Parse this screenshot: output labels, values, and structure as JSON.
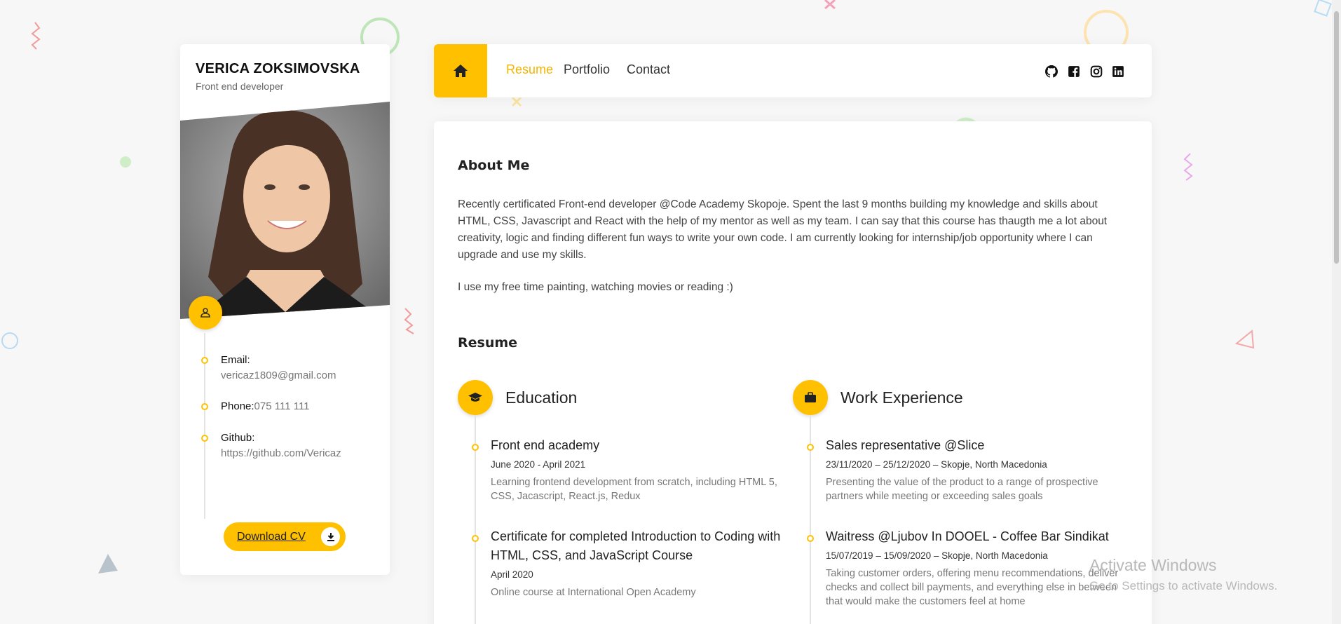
{
  "profile": {
    "name": "VERICA ZOKSIMOVSKA",
    "role": "Front end developer",
    "contacts": [
      {
        "label": "Email:",
        "value": "vericaz1809@gmail.com"
      },
      {
        "label": "Phone:",
        "value": "075 111 111"
      },
      {
        "label": "Github:",
        "value": "https://github.com/Vericaz"
      }
    ],
    "download_label": "Download CV"
  },
  "nav": {
    "links": [
      "Resume",
      "Portfolio",
      "Contact"
    ],
    "active": "Resume",
    "social_icons": [
      "github-icon",
      "facebook-icon",
      "instagram-icon",
      "linkedin-icon"
    ]
  },
  "about": {
    "title": "About Me",
    "paragraph1": "Recently certificated Front-end developer @Code Academy Skopoje. Spent the last 9 months building my knowledge and skills about HTML, CSS, Javascript and React with the help of my mentor as well as my team. I can say that this course has thaugth me a lot about creativity, logic and finding different fun ways to write your own code. I am currently looking for internship/job opportunity where I can upgrade and use my skills.",
    "paragraph2": "I use my free time painting, watching movies or reading :)"
  },
  "resume": {
    "title": "Resume",
    "education": {
      "title": "Education",
      "entries": [
        {
          "title": "Front end academy",
          "date": "June 2020 - April 2021",
          "desc": "Learning frontend development from scratch, including HTML 5, CSS, Jacascript, React.js, Redux"
        },
        {
          "title": "Certificate for completed Introduction to Coding with HTML, CSS, and JavaScript Course",
          "date": "April 2020",
          "desc": "Online course at International Open Academy"
        }
      ]
    },
    "work": {
      "title": "Work Experience",
      "entries": [
        {
          "title": "Sales representative @Slice",
          "date": "23/11/2020 – 25/12/2020 – Skopje, North Macedonia",
          "desc": "Presenting the value of the product to a range of prospective partners while meeting or exceeding sales goals"
        },
        {
          "title": "Waitress @Ljubov In DOOEL - Coffee Bar Sindikat",
          "date": "15/07/2019 – 15/09/2020 – Skopje, North Macedonia",
          "desc": "Taking customer orders, offering menu recommendations, deliver checks and collect bill payments, and everything else in between that would make the customers feel at home"
        }
      ]
    }
  },
  "watermark": {
    "line1": "Activate Windows",
    "line2": "Go to Settings to activate Windows."
  },
  "colors": {
    "accent": "#ffc000",
    "background": "#f7f7f7"
  }
}
